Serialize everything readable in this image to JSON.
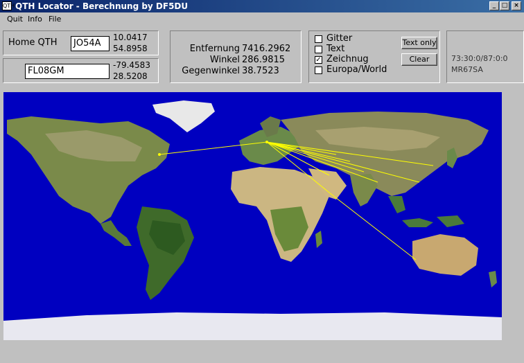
{
  "window": {
    "title": "QTH Locator - Berechnung by DF5DU",
    "app_icon": "QTH"
  },
  "menu": [
    "Quit",
    "Info",
    "File"
  ],
  "home": {
    "label": "Home QTH",
    "locator": "JO54A",
    "lon": "10.0417",
    "lat": "54.8958"
  },
  "dest": {
    "locator": "FL08GM",
    "lon": "-79.4583",
    "lat": "28.5208"
  },
  "results": {
    "distance_label": "Entfernung",
    "distance": "7416.2962",
    "angle_label": "Winkel",
    "angle": "286.9815",
    "reverse_label": "Gegenwinkel",
    "reverse": "38.7523"
  },
  "options": [
    {
      "label": "Gitter",
      "checked": false
    },
    {
      "label": "Text",
      "checked": false
    },
    {
      "label": "Zeichnug",
      "checked": true
    },
    {
      "label": "Europa/World",
      "checked": false
    }
  ],
  "buttons": {
    "text_only": "Text only",
    "clear": "Clear"
  },
  "status": {
    "coords": "73:30:0/87:0:0",
    "locator": "MR67SA"
  },
  "map": {
    "ocean_color": "#0000c0",
    "line_color": "#ffff00"
  }
}
